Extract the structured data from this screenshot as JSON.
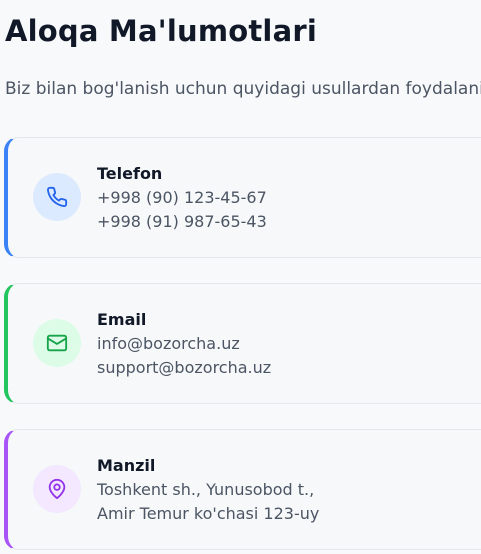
{
  "page": {
    "title": "Aloqa Ma'lumotlari",
    "subtitle": "Biz bilan bog'lanish uchun quyidagi usullardan foydalanin"
  },
  "cards": [
    {
      "title": "Telefon",
      "icon": "phone-icon",
      "accent": "#3b82f6",
      "lines": [
        "+998 (90) 123-45-67",
        "+998 (91) 987-65-43"
      ]
    },
    {
      "title": "Email",
      "icon": "mail-icon",
      "accent": "#22c55e",
      "lines": [
        "info@bozorcha.uz",
        "support@bozorcha.uz"
      ]
    },
    {
      "title": "Manzil",
      "icon": "map-pin-icon",
      "accent": "#a855f7",
      "lines": [
        "Toshkent sh., Yunusobod t.,",
        "Amir Temur ko'chasi 123-uy"
      ]
    }
  ]
}
